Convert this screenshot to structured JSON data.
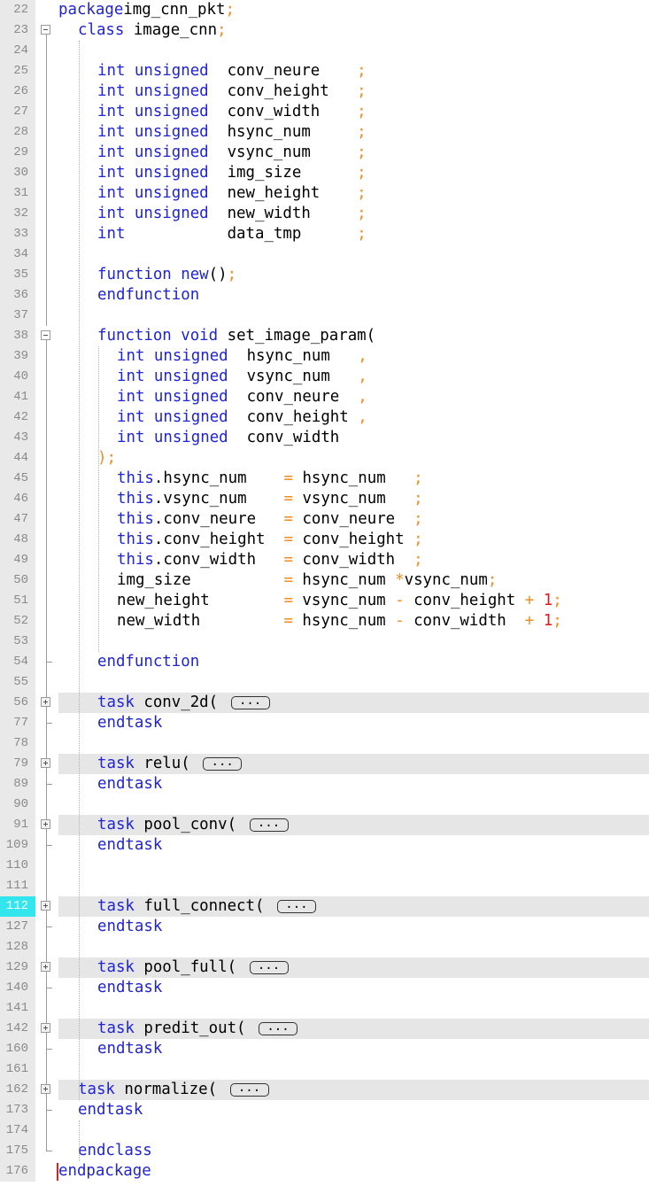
{
  "editor": {
    "current_line": "112",
    "lines": [
      {
        "n": "22",
        "fold": "none",
        "indent": 0,
        "t": [
          [
            "k",
            "package"
          ],
          [
            "",
            "img_cnn_pkt"
          ],
          [
            "p",
            ";"
          ]
        ]
      },
      {
        "n": "23",
        "fold": "open",
        "indent": 1,
        "t": [
          [
            "k",
            "class"
          ],
          [
            "",
            " image_cnn"
          ],
          [
            "p",
            ";"
          ]
        ]
      },
      {
        "n": "24",
        "fold": "line",
        "indent": 0,
        "t": []
      },
      {
        "n": "25",
        "fold": "line",
        "indent": 2,
        "t": [
          [
            "k",
            "int unsigned"
          ],
          [
            "",
            "  conv_neure    "
          ],
          [
            "p",
            ";"
          ]
        ]
      },
      {
        "n": "26",
        "fold": "line",
        "indent": 2,
        "t": [
          [
            "k",
            "int unsigned"
          ],
          [
            "",
            "  conv_height   "
          ],
          [
            "p",
            ";"
          ]
        ]
      },
      {
        "n": "27",
        "fold": "line",
        "indent": 2,
        "t": [
          [
            "k",
            "int unsigned"
          ],
          [
            "",
            "  conv_width    "
          ],
          [
            "p",
            ";"
          ]
        ]
      },
      {
        "n": "28",
        "fold": "line",
        "indent": 2,
        "t": [
          [
            "k",
            "int unsigned"
          ],
          [
            "",
            "  hsync_num     "
          ],
          [
            "p",
            ";"
          ]
        ]
      },
      {
        "n": "29",
        "fold": "line",
        "indent": 2,
        "t": [
          [
            "k",
            "int unsigned"
          ],
          [
            "",
            "  vsync_num     "
          ],
          [
            "p",
            ";"
          ]
        ]
      },
      {
        "n": "30",
        "fold": "line",
        "indent": 2,
        "t": [
          [
            "k",
            "int unsigned"
          ],
          [
            "",
            "  img_size      "
          ],
          [
            "p",
            ";"
          ]
        ]
      },
      {
        "n": "31",
        "fold": "line",
        "indent": 2,
        "t": [
          [
            "k",
            "int unsigned"
          ],
          [
            "",
            "  new_height    "
          ],
          [
            "p",
            ";"
          ]
        ]
      },
      {
        "n": "32",
        "fold": "line",
        "indent": 2,
        "t": [
          [
            "k",
            "int unsigned"
          ],
          [
            "",
            "  new_width     "
          ],
          [
            "p",
            ";"
          ]
        ]
      },
      {
        "n": "33",
        "fold": "line",
        "indent": 2,
        "t": [
          [
            "k",
            "int"
          ],
          [
            "",
            "           data_tmp      "
          ],
          [
            "p",
            ";"
          ]
        ]
      },
      {
        "n": "34",
        "fold": "line",
        "indent": 0,
        "t": []
      },
      {
        "n": "35",
        "fold": "line",
        "indent": 2,
        "t": [
          [
            "k",
            "function new"
          ],
          [
            "",
            "()"
          ],
          [
            "p",
            ";"
          ]
        ]
      },
      {
        "n": "36",
        "fold": "line",
        "indent": 2,
        "t": [
          [
            "k",
            "endfunction"
          ]
        ]
      },
      {
        "n": "37",
        "fold": "line",
        "indent": 0,
        "t": []
      },
      {
        "n": "38",
        "fold": "open",
        "indent": 2,
        "t": [
          [
            "k",
            "function void"
          ],
          [
            "",
            " set_image_param("
          ]
        ]
      },
      {
        "n": "39",
        "fold": "line",
        "indent": 3,
        "t": [
          [
            "k",
            "int unsigned"
          ],
          [
            "",
            "  hsync_num   "
          ],
          [
            "p",
            ","
          ]
        ]
      },
      {
        "n": "40",
        "fold": "line",
        "indent": 3,
        "t": [
          [
            "k",
            "int unsigned"
          ],
          [
            "",
            "  vsync_num   "
          ],
          [
            "p",
            ","
          ]
        ]
      },
      {
        "n": "41",
        "fold": "line",
        "indent": 3,
        "t": [
          [
            "k",
            "int unsigned"
          ],
          [
            "",
            "  conv_neure  "
          ],
          [
            "p",
            ","
          ]
        ]
      },
      {
        "n": "42",
        "fold": "line",
        "indent": 3,
        "t": [
          [
            "k",
            "int unsigned"
          ],
          [
            "",
            "  conv_height "
          ],
          [
            "p",
            ","
          ]
        ]
      },
      {
        "n": "43",
        "fold": "line",
        "indent": 3,
        "t": [
          [
            "k",
            "int unsigned"
          ],
          [
            "",
            "  conv_width"
          ]
        ]
      },
      {
        "n": "44",
        "fold": "line",
        "indent": 2,
        "t": [
          [
            "p",
            ")"
          ],
          [
            "p",
            ";"
          ]
        ]
      },
      {
        "n": "45",
        "fold": "line",
        "indent": 3,
        "t": [
          [
            "k",
            "this"
          ],
          [
            "",
            ".hsync_num    "
          ],
          [
            "p",
            "="
          ],
          [
            "",
            " hsync_num   "
          ],
          [
            "p",
            ";"
          ]
        ]
      },
      {
        "n": "46",
        "fold": "line",
        "indent": 3,
        "t": [
          [
            "k",
            "this"
          ],
          [
            "",
            ".vsync_num    "
          ],
          [
            "p",
            "="
          ],
          [
            "",
            " vsync_num   "
          ],
          [
            "p",
            ";"
          ]
        ]
      },
      {
        "n": "47",
        "fold": "line",
        "indent": 3,
        "t": [
          [
            "k",
            "this"
          ],
          [
            "",
            ".conv_neure   "
          ],
          [
            "p",
            "="
          ],
          [
            "",
            " conv_neure  "
          ],
          [
            "p",
            ";"
          ]
        ]
      },
      {
        "n": "48",
        "fold": "line",
        "indent": 3,
        "t": [
          [
            "k",
            "this"
          ],
          [
            "",
            ".conv_height  "
          ],
          [
            "p",
            "="
          ],
          [
            "",
            " conv_height "
          ],
          [
            "p",
            ";"
          ]
        ]
      },
      {
        "n": "49",
        "fold": "line",
        "indent": 3,
        "t": [
          [
            "k",
            "this"
          ],
          [
            "",
            ".conv_width   "
          ],
          [
            "p",
            "="
          ],
          [
            "",
            " conv_width  "
          ],
          [
            "p",
            ";"
          ]
        ]
      },
      {
        "n": "50",
        "fold": "line",
        "indent": 3,
        "t": [
          [
            "",
            "img_size          "
          ],
          [
            "p",
            "="
          ],
          [
            "",
            " hsync_num "
          ],
          [
            "p",
            "*"
          ],
          [
            "",
            "vsync_num"
          ],
          [
            "p",
            ";"
          ]
        ]
      },
      {
        "n": "51",
        "fold": "line",
        "indent": 3,
        "t": [
          [
            "",
            "new_height        "
          ],
          [
            "p",
            "="
          ],
          [
            "",
            " vsync_num "
          ],
          [
            "p",
            "-"
          ],
          [
            "",
            " conv_height "
          ],
          [
            "p",
            "+"
          ],
          [
            "",
            " "
          ],
          [
            "n",
            "1"
          ],
          [
            "p",
            ";"
          ]
        ]
      },
      {
        "n": "52",
        "fold": "line",
        "indent": 3,
        "t": [
          [
            "",
            "new_width         "
          ],
          [
            "p",
            "="
          ],
          [
            "",
            " hsync_num "
          ],
          [
            "p",
            "-"
          ],
          [
            "",
            " conv_width  "
          ],
          [
            "p",
            "+"
          ],
          [
            "",
            " "
          ],
          [
            "n",
            "1"
          ],
          [
            "p",
            ";"
          ]
        ]
      },
      {
        "n": "53",
        "fold": "line",
        "indent": 0,
        "t": []
      },
      {
        "n": "54",
        "fold": "end",
        "indent": 2,
        "t": [
          [
            "k",
            "endfunction"
          ]
        ]
      },
      {
        "n": "55",
        "fold": "line",
        "indent": 0,
        "t": []
      },
      {
        "n": "56",
        "fold": "closed",
        "indent": 2,
        "t": [
          [
            "k",
            "task"
          ],
          [
            "",
            " conv_2d( "
          ],
          [
            "e",
            "..."
          ]
        ]
      },
      {
        "n": "77",
        "fold": "end",
        "indent": 2,
        "t": [
          [
            "k",
            "endtask"
          ]
        ]
      },
      {
        "n": "78",
        "fold": "line",
        "indent": 0,
        "t": []
      },
      {
        "n": "79",
        "fold": "closed",
        "indent": 2,
        "t": [
          [
            "k",
            "task"
          ],
          [
            "",
            " relu( "
          ],
          [
            "e",
            "..."
          ]
        ]
      },
      {
        "n": "89",
        "fold": "end",
        "indent": 2,
        "t": [
          [
            "k",
            "endtask"
          ]
        ]
      },
      {
        "n": "90",
        "fold": "line",
        "indent": 0,
        "t": []
      },
      {
        "n": "91",
        "fold": "closed",
        "indent": 2,
        "t": [
          [
            "k",
            "task"
          ],
          [
            "",
            " pool_conv( "
          ],
          [
            "e",
            "..."
          ]
        ]
      },
      {
        "n": "109",
        "fold": "end",
        "indent": 2,
        "t": [
          [
            "k",
            "endtask"
          ]
        ]
      },
      {
        "n": "110",
        "fold": "line",
        "indent": 0,
        "t": []
      },
      {
        "n": "111",
        "fold": "line",
        "indent": 0,
        "t": []
      },
      {
        "n": "112",
        "fold": "closed",
        "indent": 2,
        "t": [
          [
            "k",
            "task"
          ],
          [
            "",
            " full_connect( "
          ],
          [
            "e",
            "..."
          ]
        ]
      },
      {
        "n": "127",
        "fold": "end",
        "indent": 2,
        "t": [
          [
            "k",
            "endtask"
          ]
        ]
      },
      {
        "n": "128",
        "fold": "line",
        "indent": 0,
        "t": []
      },
      {
        "n": "129",
        "fold": "closed",
        "indent": 2,
        "t": [
          [
            "k",
            "task"
          ],
          [
            "",
            " pool_full( "
          ],
          [
            "e",
            "..."
          ]
        ]
      },
      {
        "n": "140",
        "fold": "end",
        "indent": 2,
        "t": [
          [
            "k",
            "endtask"
          ]
        ]
      },
      {
        "n": "141",
        "fold": "line",
        "indent": 0,
        "t": []
      },
      {
        "n": "142",
        "fold": "closed",
        "indent": 2,
        "t": [
          [
            "k",
            "task"
          ],
          [
            "",
            " predit_out( "
          ],
          [
            "e",
            "..."
          ]
        ]
      },
      {
        "n": "160",
        "fold": "end",
        "indent": 2,
        "t": [
          [
            "k",
            "endtask"
          ]
        ]
      },
      {
        "n": "161",
        "fold": "line",
        "indent": 0,
        "t": []
      },
      {
        "n": "162",
        "fold": "closed",
        "indent": 1,
        "t": [
          [
            "k",
            "task"
          ],
          [
            "",
            " normalize( "
          ],
          [
            "e",
            "..."
          ]
        ]
      },
      {
        "n": "173",
        "fold": "end",
        "indent": 1,
        "t": [
          [
            "k",
            "endtask"
          ]
        ]
      },
      {
        "n": "174",
        "fold": "line",
        "indent": 0,
        "t": []
      },
      {
        "n": "175",
        "fold": "end",
        "indent": 1,
        "t": [
          [
            "k",
            "endclass"
          ]
        ]
      },
      {
        "n": "176",
        "fold": "none",
        "indent": 0,
        "t": [
          [
            "k",
            "endpackage"
          ]
        ]
      }
    ]
  }
}
